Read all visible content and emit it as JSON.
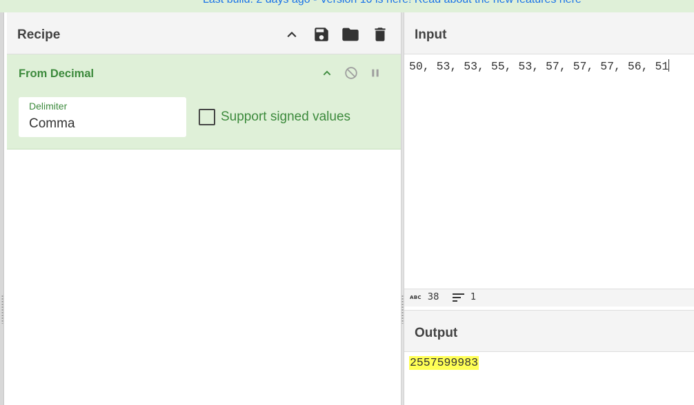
{
  "banner": {
    "text": "Last build: 2 days ago - Version 10 is here! Read about the new features ",
    "link_text": "here",
    "link_color": "#1a73e8"
  },
  "recipe": {
    "title": "Recipe",
    "header_icons": [
      "chevron-up-icon",
      "save-icon",
      "folder-icon",
      "trash-icon"
    ],
    "operation": {
      "title": "From Decimal",
      "icons": [
        "chevron-up-icon",
        "disable-icon",
        "pause-icon"
      ],
      "delimiter_label": "Delimiter",
      "delimiter_value": "Comma",
      "checkbox_label": "Support signed values",
      "checkbox_checked": false,
      "accent_color": "#3c8a3c",
      "background_color": "#dff0d8"
    }
  },
  "input": {
    "title": "Input",
    "text": "50, 53, 53, 55, 53, 57, 57, 57, 56, 51",
    "char_count": "38",
    "line_count": "1"
  },
  "output": {
    "title": "Output",
    "text": "2557599983",
    "highlight_color": "#ffff55"
  }
}
